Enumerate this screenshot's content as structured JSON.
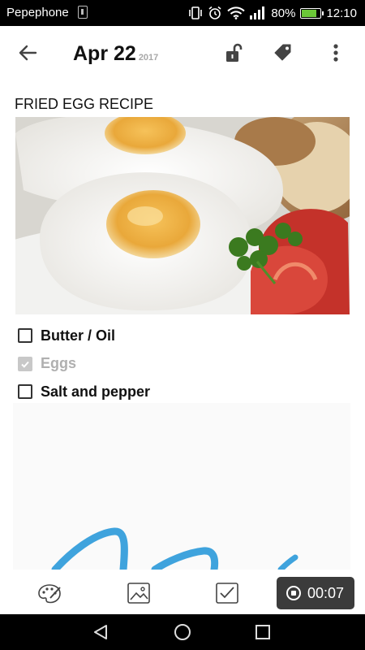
{
  "status_bar": {
    "carrier": "Pepephone",
    "battery_percent": "80%",
    "battery_level": 0.8,
    "time": "12:10"
  },
  "app_bar": {
    "date": "Apr 22",
    "year": "2017",
    "icons": [
      "back-arrow-icon",
      "unlock-icon",
      "tag-icon",
      "more-vert-icon"
    ]
  },
  "note": {
    "title": "FRIED EGG RECIPE",
    "image": "fried-egg-photo",
    "checklist": [
      {
        "label": "Butter / Oil",
        "checked": false
      },
      {
        "label": "Eggs",
        "checked": true
      },
      {
        "label": "Salt and pepper",
        "checked": false
      }
    ]
  },
  "toolbar": {
    "icons": [
      "palette-icon",
      "image-icon",
      "checkbox-icon"
    ],
    "record_time": "00:07"
  },
  "colors": {
    "sketch_stroke": "#3fa3dd",
    "battery_fill": "#6bc738",
    "record_button": "#3b3b3b"
  }
}
